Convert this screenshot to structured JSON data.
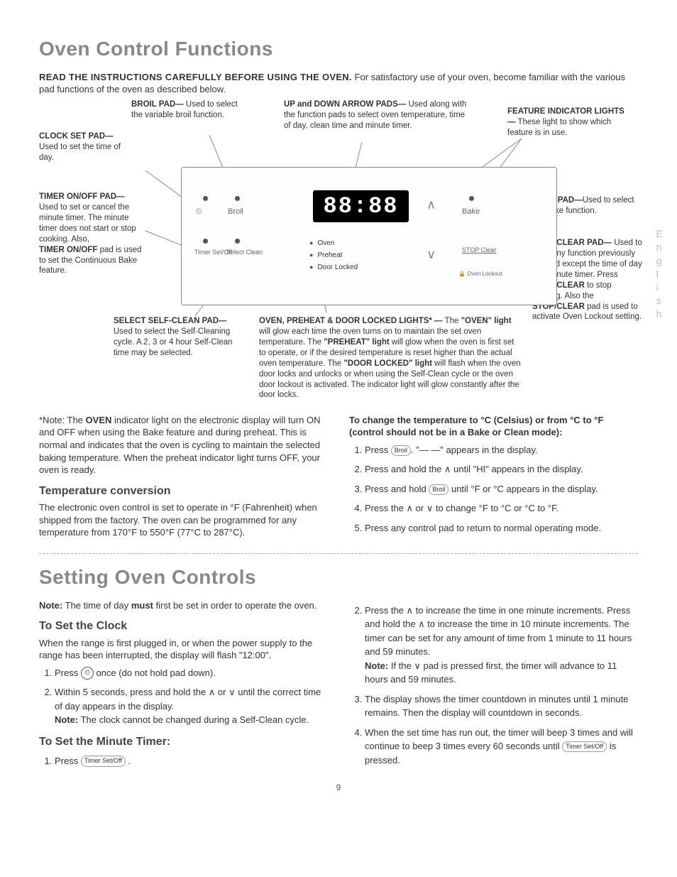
{
  "title1": "Oven Control Functions",
  "intro_bold": "READ THE INSTRUCTIONS CAREFULLY BEFORE USING THE OVEN.",
  "intro_rest": " For satisfactory use of your oven, become familiar with the various pad functions of the oven as described below.",
  "callouts": {
    "broil": {
      "head": "BROIL PAD—",
      "body": " Used to select the variable broil function."
    },
    "arrows": {
      "head": "UP and DOWN ARROW PADS—",
      "body": " Used along with the function pads to select oven temperature, time of day, clean time and minute timer."
    },
    "feature": {
      "head": "FEATURE INDICATOR LIGHTS—",
      "body": " These light to show which feature is in use."
    },
    "clock": {
      "head": "CLOCK SET PAD—",
      "body": " Used to set the time of day."
    },
    "timer": {
      "head": "TIMER ON/OFF PAD—",
      "body": " Used to set or cancel the minute timer. The minute timer does not start or stop cooking. Also,",
      "head2": "TIMER ON/OFF",
      "body2": " pad is used to set the Continuous Bake feature."
    },
    "bake": {
      "head": "BAKE PAD—",
      "body": "Used to select the bake function."
    },
    "stop": {
      "head": "STOP/CLEAR PAD—",
      "body": " Used to clear any function previously entered except the time of day and minute timer. Press ",
      "mid": "STOP/CLEAR",
      "body2": " to stop cooking. Also the ",
      "mid2": "STOP/CLEAR",
      "body3": " pad is used to activate Oven Lockout setting."
    },
    "self": {
      "head": "SELECT SELF-CLEAN PAD—",
      "body": " Used to select the Self-Cleaning cycle. A 2, 3 or 4 hour Self-Clean time may be selected."
    },
    "lights": {
      "head": "OVEN, PREHEAT & DOOR LOCKED LIGHTS* —",
      "body": " The ",
      "b1": "\"OVEN\" light",
      "body2": " will glow each time the oven turns on to maintain the set oven temperature. The ",
      "b2": "\"PREHEAT\" light",
      "body3": " will glow when the oven is first set to operate, or if the desired temperature is reset higher than the actual oven temperature. The ",
      "b3": "\"DOOR LOCKED\" light",
      "body4": " will flash when the oven door locks and unlocks or when using the Self-Clean cycle or the oven door lockout is activated. The indicator light will glow constantly after the door locks."
    }
  },
  "panel": {
    "display": "88:88",
    "broil": "Broil",
    "bake": "Bake",
    "timer": "Timer Set/Off",
    "select": "Select Clean",
    "stop": "STOP Clear",
    "ind_oven": "Oven",
    "ind_preheat": "Preheat",
    "ind_door": "Door Locked",
    "lockout": "Oven Lockout"
  },
  "note_oven": "*Note: The ",
  "note_oven_b": "OVEN",
  "note_oven2": " indicator light on the electronic display will turn ON and OFF when using the Bake feature and during preheat. This is normal and indicates that the oven is cycling to maintain the selected baking temperature. When the preheat indicator light turns OFF, your oven is ready.",
  "temp_h": "Temperature conversion",
  "temp_p": "The electronic oven control is set to operate in °F (Fahrenheit) when shipped from the factory. The oven can be programmed for any temperature from 170°F to 550°F (77°C to 287°C).",
  "c_head": "To change the temperature to °C (Celsius) or from °C to °F (control should not be in a Bake or Clean mode):",
  "c1a": "Press ",
  "c1b": ". \"— —\" appears in the display.",
  "c2": "Press and hold the  ∧  until \"HI\" appears in the display.",
  "c3a": "Press and hold ",
  "c3b": " until °F or °C appears in the display.",
  "c4": "Press the  ∧  or  ∨  to change °F to °C or °C to °F.",
  "c5": "Press any control pad to return to normal operating mode.",
  "title2": "Setting Oven Controls",
  "note2a": "Note:",
  "note2b": " The time of day ",
  "note2c": "must",
  "note2d": " first be set in order to operate the oven.",
  "clock_h": "To Set the Clock",
  "clock_p": "When the range is first plugged in, or when the power supply to the range has been interrupted, the display will flash \"12:00\".",
  "cl1a": "Press ",
  "cl1b": " once (do not hold pad down).",
  "cl2a": "Within 5 seconds, press and hold the  ∧  or ∨  until the correct time of day appears in the display.",
  "cl2n": "Note:",
  "cl2nb": " The clock cannot be changed during a Self-Clean cycle.",
  "min_h": "To Set the Minute Timer:",
  "m1a": "Press ",
  "m1b": " .",
  "m2a": "Press the  ∧  to increase the time in one minute increments. Press and hold the  ∧  to increase the time in 10 minute increments. The timer can be set for any amount of time from 1 minute to 11 hours and 59 minutes.",
  "m2n": "Note:",
  "m2nb": " If the  ∨  pad is pressed first, the timer will advance to 11 hours and 59 minutes.",
  "m3": "The display shows the timer countdown in minutes until 1 minute remains. Then the display will countdown in seconds.",
  "m4a": "When the set time has run out, the timer will beep 3 times and will continue to beep 3 times every 60 seconds until ",
  "m4b": " is pressed.",
  "broil_pad": "Broil",
  "timer_pad": "Timer Set/Off",
  "pagenum": "9",
  "side": "English"
}
